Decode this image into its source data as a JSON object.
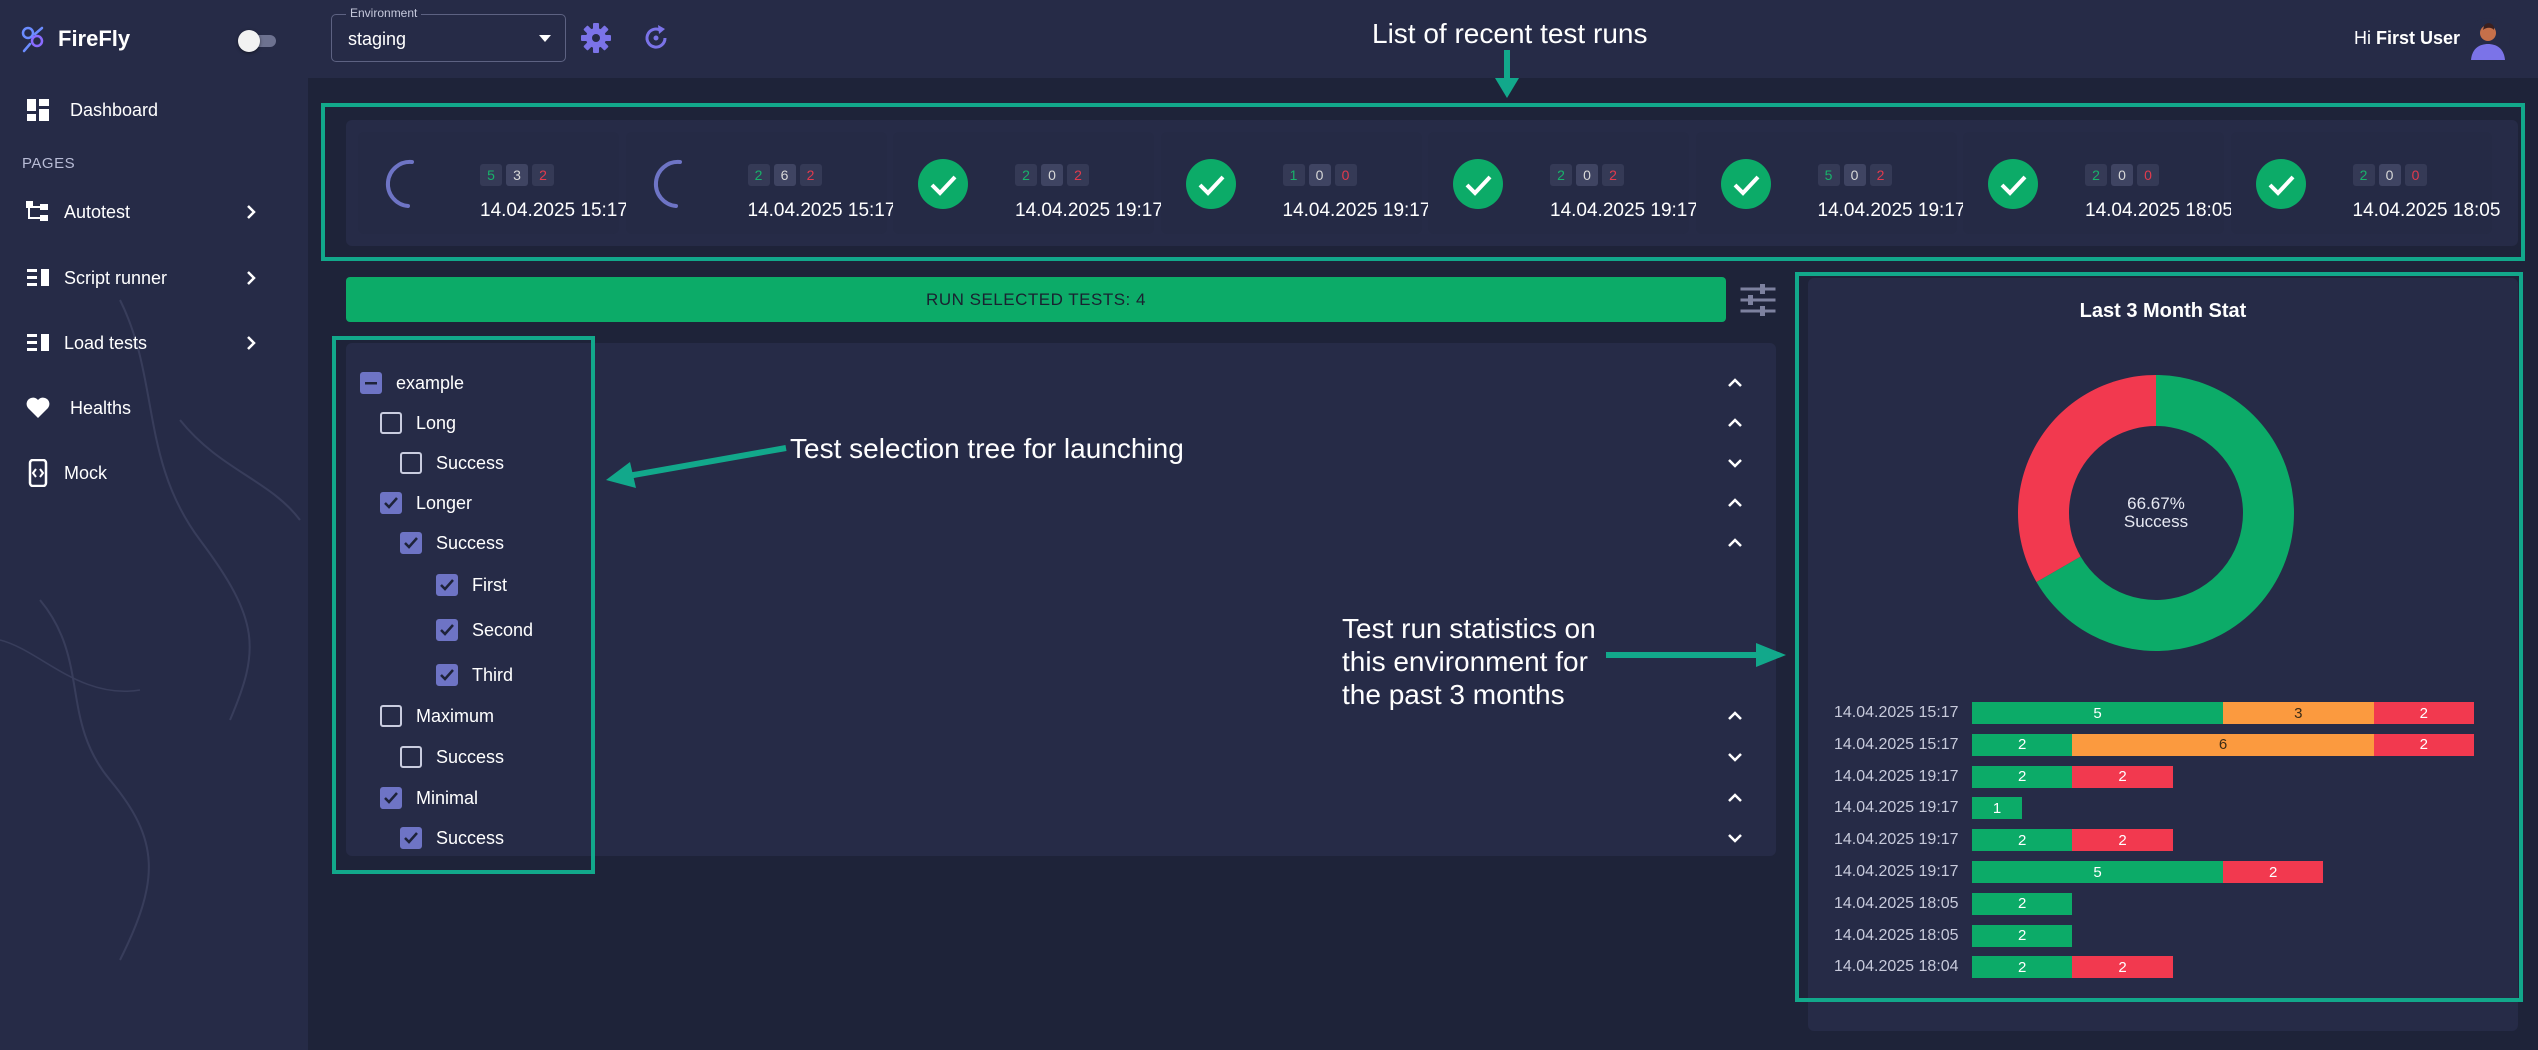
{
  "app": {
    "name": "FireFly",
    "greeting_prefix": "Hi",
    "user_name": "First User"
  },
  "colors": {
    "success": "#0cab68",
    "running": "#fb9a3f",
    "failed": "#f2394f",
    "accent": "#6e74c5",
    "highlight": "#12a88b"
  },
  "sidebar": {
    "pages_title": "PAGES",
    "items": [
      {
        "label": "Dashboard",
        "icon": "dashboard-icon",
        "has_submenu": false
      },
      {
        "label": "Autotest",
        "icon": "tree-icon",
        "has_submenu": true
      },
      {
        "label": "Script runner",
        "icon": "list-icon",
        "has_submenu": true
      },
      {
        "label": "Load tests",
        "icon": "list-icon",
        "has_submenu": true
      },
      {
        "label": "Healths",
        "icon": "heart-icon",
        "has_submenu": false
      },
      {
        "label": "Mock",
        "icon": "mock-icon",
        "has_submenu": false
      }
    ]
  },
  "topbar": {
    "environment_label": "Environment",
    "environment_value": "staging"
  },
  "annotations": {
    "recent_runs": "List of recent test runs",
    "tree": "Test selection tree for launching",
    "stats_line1": "Test run statistics on",
    "stats_line2": "this environment for",
    "stats_line3": "the past 3 months"
  },
  "recent_runs": [
    {
      "state": "running",
      "success": "5",
      "running": "3",
      "failed": "2",
      "date": "14.04.2025 15:17"
    },
    {
      "state": "running",
      "success": "2",
      "running": "6",
      "failed": "2",
      "date": "14.04.2025 15:17"
    },
    {
      "state": "done",
      "success": "2",
      "running": "0",
      "failed": "2",
      "date": "14.04.2025 19:17"
    },
    {
      "state": "done",
      "success": "1",
      "running": "0",
      "failed": "0",
      "date": "14.04.2025 19:17"
    },
    {
      "state": "done",
      "success": "2",
      "running": "0",
      "failed": "2",
      "date": "14.04.2025 19:17"
    },
    {
      "state": "done",
      "success": "5",
      "running": "0",
      "failed": "2",
      "date": "14.04.2025 19:17"
    },
    {
      "state": "done",
      "success": "2",
      "running": "0",
      "failed": "0",
      "date": "14.04.2025 18:05"
    },
    {
      "state": "done",
      "success": "2",
      "running": "0",
      "failed": "0",
      "date": "14.04.2025 18:05"
    }
  ],
  "run_button": {
    "label": "RUN SELECTED TESTS: 4"
  },
  "tree": [
    {
      "label": "example",
      "level": 0,
      "state": "partial",
      "expanded": true
    },
    {
      "label": "Long",
      "level": 1,
      "state": "unchecked",
      "expanded": true
    },
    {
      "label": "Success",
      "level": 2,
      "state": "unchecked",
      "expanded": false
    },
    {
      "label": "Longer",
      "level": 1,
      "state": "checked",
      "expanded": true
    },
    {
      "label": "Success",
      "level": 2,
      "state": "checked",
      "expanded": true
    },
    {
      "label": "First",
      "level": 3,
      "state": "checked",
      "leaf": true
    },
    {
      "label": "Second",
      "level": 3,
      "state": "checked",
      "leaf": true
    },
    {
      "label": "Third",
      "level": 3,
      "state": "checked",
      "leaf": true
    },
    {
      "label": "Maximum",
      "level": 1,
      "state": "unchecked",
      "expanded": true
    },
    {
      "label": "Success",
      "level": 2,
      "state": "unchecked",
      "expanded": false
    },
    {
      "label": "Minimal",
      "level": 1,
      "state": "checked",
      "expanded": true
    },
    {
      "label": "Success",
      "level": 2,
      "state": "checked",
      "expanded": false
    }
  ],
  "stats": {
    "title": "Last 3 Month Stat",
    "donut_percent": "66.67%",
    "donut_caption": "Success",
    "rows": [
      {
        "date": "14.04.2025 15:17",
        "success": 5,
        "running": 3,
        "failed": 2
      },
      {
        "date": "14.04.2025 15:17",
        "success": 2,
        "running": 6,
        "failed": 2
      },
      {
        "date": "14.04.2025 19:17",
        "success": 2,
        "running": 0,
        "failed": 2
      },
      {
        "date": "14.04.2025 19:17",
        "success": 1,
        "running": 0,
        "failed": 0
      },
      {
        "date": "14.04.2025 19:17",
        "success": 2,
        "running": 0,
        "failed": 2
      },
      {
        "date": "14.04.2025 19:17",
        "success": 5,
        "running": 0,
        "failed": 2
      },
      {
        "date": "14.04.2025 18:05",
        "success": 2,
        "running": 0,
        "failed": 0
      },
      {
        "date": "14.04.2025 18:05",
        "success": 2,
        "running": 0,
        "failed": 0
      },
      {
        "date": "14.04.2025 18:04",
        "success": 2,
        "running": 0,
        "failed": 2
      }
    ]
  },
  "chart_data": {
    "type": "pie",
    "title": "Last 3 Month Stat",
    "labels": [
      "Success",
      "Failed"
    ],
    "values": [
      66.67,
      33.33
    ],
    "center_text": "66.67% Success"
  }
}
